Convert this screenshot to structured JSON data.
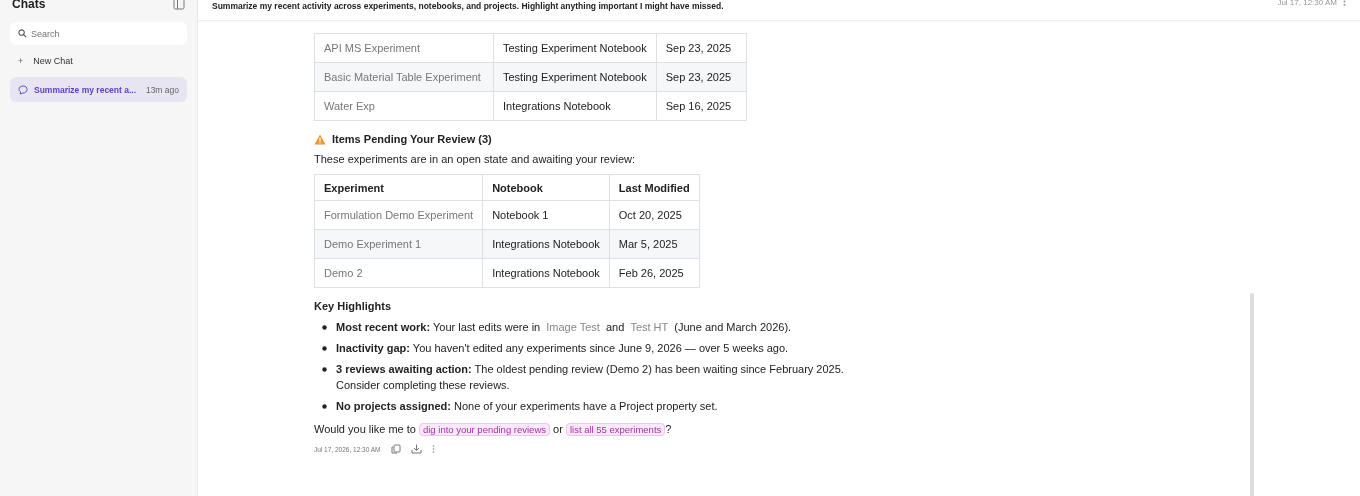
{
  "sidebar": {
    "title": "Chats",
    "search": {
      "placeholder": "Search"
    },
    "new_chat": {
      "icon": "+",
      "label": "New Chat"
    },
    "items": [
      {
        "title": "Summarize my recent a...",
        "time": "13m ago",
        "selected": true
      }
    ]
  },
  "header": {
    "message": "Summarize my recent activity across experiments, notebooks, and projects. Highlight anything important I might have missed.",
    "time": "Jul 17, 12:30 AM"
  },
  "recent_table": {
    "rows": [
      {
        "experiment": "API MS Experiment",
        "notebook": "Testing Experiment Notebook",
        "modified": "Sep 23, 2025"
      },
      {
        "experiment": "Basic Material Table Experiment",
        "notebook": "Testing Experiment Notebook",
        "modified": "Sep 23, 2025"
      },
      {
        "experiment": "Water Exp",
        "notebook": "Integrations Notebook",
        "modified": "Sep 16, 2025"
      }
    ]
  },
  "pending": {
    "heading": "Items Pending Your Review (3)",
    "intro": "These experiments are in an open state and awaiting your review:",
    "columns": [
      "Experiment",
      "Notebook",
      "Last Modified"
    ],
    "rows": [
      {
        "experiment": "Formulation Demo Experiment",
        "notebook": "Notebook 1",
        "modified": "Oct 20, 2025"
      },
      {
        "experiment": "Demo Experiment 1",
        "notebook": "Integrations Notebook",
        "modified": "Mar 5, 2025"
      },
      {
        "experiment": "Demo 2",
        "notebook": "Integrations Notebook",
        "modified": "Feb 26, 2025"
      }
    ]
  },
  "highlights": {
    "heading": "Key Highlights",
    "items": [
      {
        "label": "Most recent work:",
        "segments": [
          {
            "kind": "text",
            "text": "Your last edits were in"
          },
          {
            "kind": "link",
            "text": "Image Test"
          },
          {
            "kind": "text",
            "text": "and"
          },
          {
            "kind": "link",
            "text": "Test HT"
          },
          {
            "kind": "text",
            "text": "(June and March 2026)."
          }
        ]
      },
      {
        "label": "Inactivity gap:",
        "segments": [
          {
            "kind": "text",
            "text": "You haven't edited any experiments since June 9, 2026 — over 5 weeks ago."
          }
        ]
      },
      {
        "label": "3 reviews awaiting action:",
        "segments": [
          {
            "kind": "text",
            "text": "The oldest pending review (Demo 2) has been waiting since February 2025. Consider completing these reviews."
          }
        ]
      },
      {
        "label": "No projects assigned:",
        "segments": [
          {
            "kind": "text",
            "text": "None of your experiments have a Project property set."
          }
        ]
      }
    ]
  },
  "followup": {
    "segments": [
      {
        "kind": "text",
        "text": "Would you like me to"
      },
      {
        "kind": "chip",
        "text": "dig into your pending reviews"
      },
      {
        "kind": "text",
        "text": "or"
      },
      {
        "kind": "chip",
        "text": "list all 55 experiments"
      },
      {
        "kind": "text",
        "text": "?"
      }
    ]
  },
  "footer": {
    "time": "Jul 17, 2026, 12:30 AM"
  }
}
